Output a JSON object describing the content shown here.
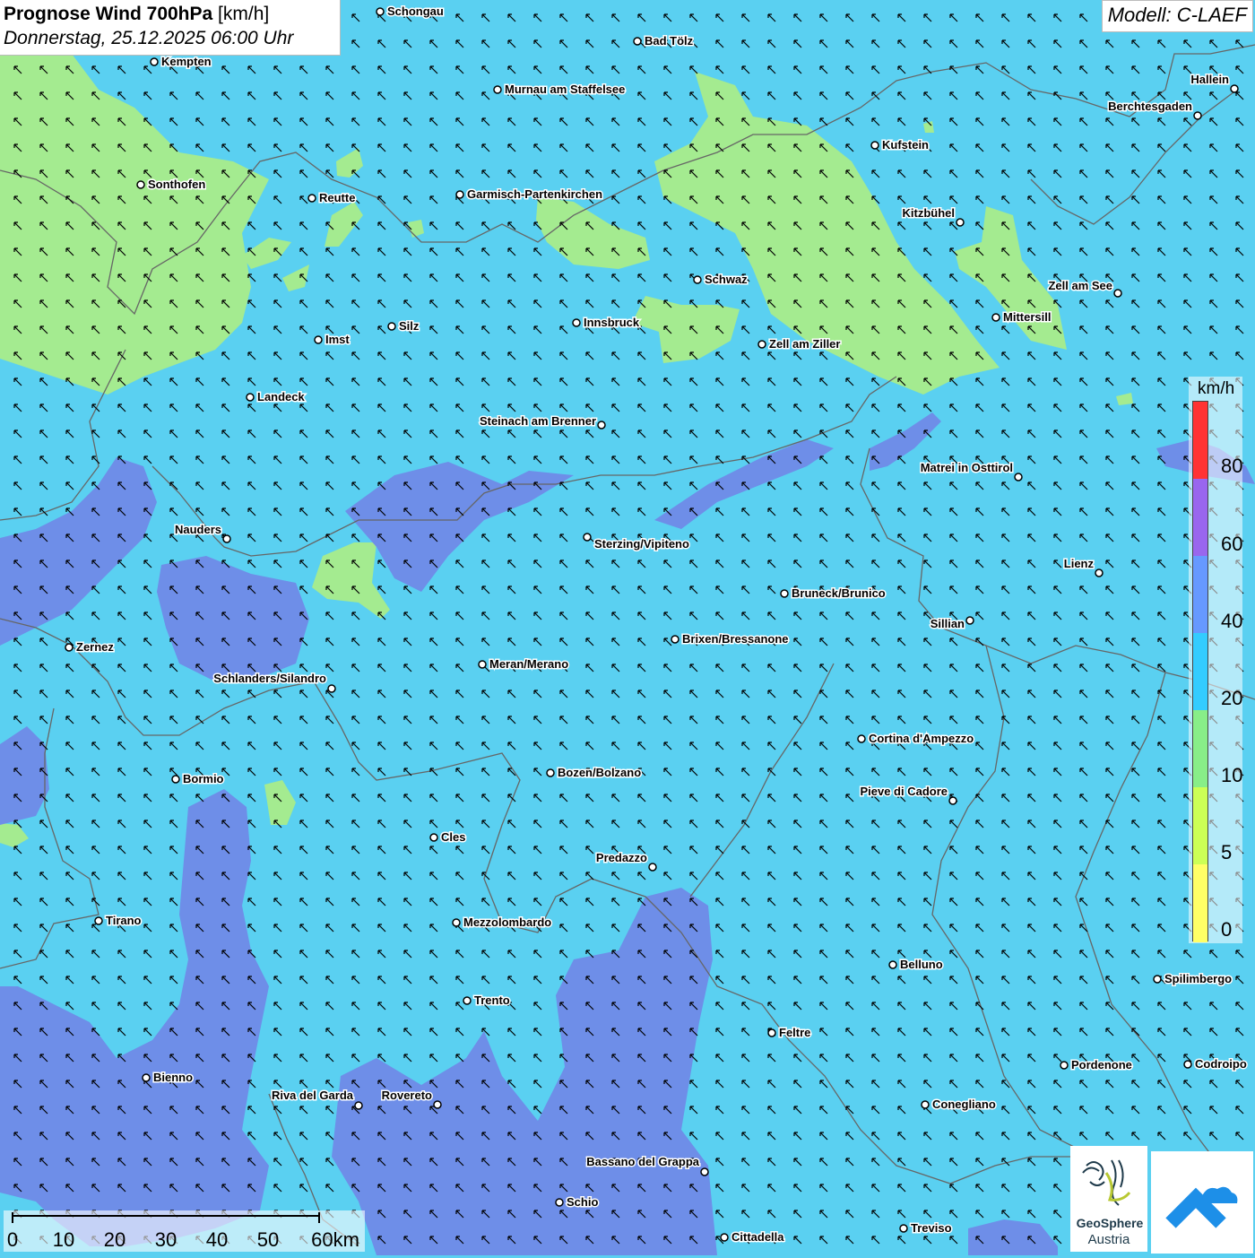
{
  "header": {
    "title_bold": "Prognose Wind 700hPa",
    "title_unit": "[km/h]",
    "datetime": "Donnerstag, 25.12.2025 06:00 Uhr",
    "model": "Modell: C-LAEF"
  },
  "legend": {
    "unit": "km/h",
    "labels": [
      "80",
      "60",
      "40",
      "20",
      "10",
      "5",
      "0"
    ],
    "colors": [
      "#ff3333",
      "#9966ee",
      "#6699ff",
      "#33ccff",
      "#88ee88",
      "#ccff55",
      "#ffff66"
    ]
  },
  "scale_bar": {
    "labels": [
      "0",
      "10",
      "20",
      "30",
      "40",
      "50",
      "60km"
    ]
  },
  "logos": {
    "geosphere_name": "GeoSphere",
    "geosphere_sub": "Austria"
  },
  "colors": {
    "wind_10_20": "#5ad0f1",
    "wind_5_10": "#a4eb90",
    "wind_20_40": "#6e8ee8",
    "border": "#666666",
    "arrow": "#000000"
  },
  "wind_direction": "from south-east (arrows pointing north-west)",
  "cities": [
    "Schongau",
    "Bad Tölz",
    "Kempten",
    "Murnau am Staffelsee",
    "Hallein",
    "Berchtesgaden",
    "Kufstein",
    "Sonthofen",
    "Reutte",
    "Garmisch-Partenkirchen",
    "Kitzbühel",
    "Schwaz",
    "Zell am See",
    "Mittersill",
    "Innsbruck",
    "Silz",
    "Imst",
    "Zell am Ziller",
    "Landeck",
    "Steinach am Brenner",
    "Matrei in Osttirol",
    "Nauders",
    "Sterzing/Vipiteno",
    "Lienz",
    "Bruneck/Brunico",
    "Sillian",
    "Zernez",
    "Brixen/Bressanone",
    "Meran/Merano",
    "Schlanders/Silandro",
    "Cortina d'Ampezzo",
    "Bozen/Bolzano",
    "Bormio",
    "Pieve di Cadore",
    "Cles",
    "Predazzo",
    "Tirano",
    "Mezzolombardo",
    "Belluno",
    "Spilimbergo",
    "Trento",
    "Feltre",
    "Pordenone",
    "Codroipo",
    "Bienno",
    "Riva del Garda",
    "Rovereto",
    "Conegliano",
    "Bassano del Grappa",
    "Schio",
    "Treviso",
    "Cittadella"
  ]
}
